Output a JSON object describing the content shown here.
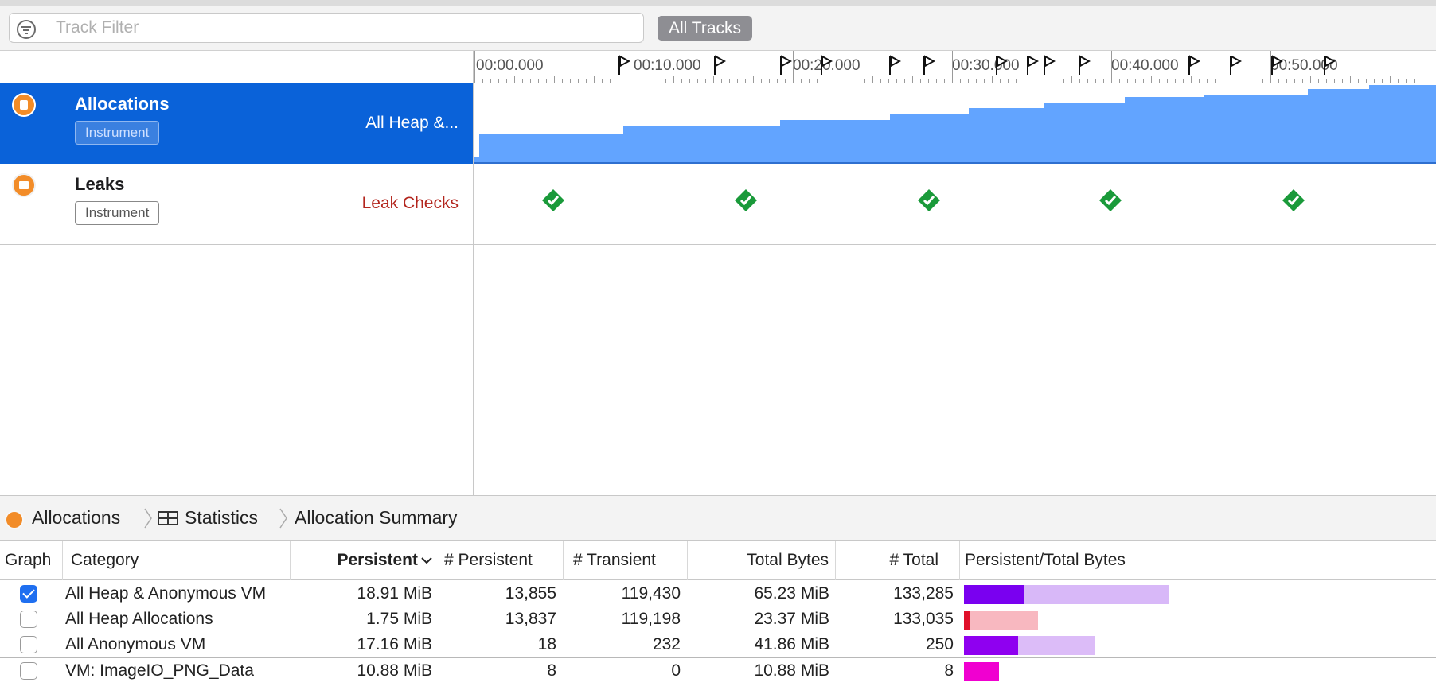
{
  "filter": {
    "placeholder": "Track Filter",
    "all_tracks_label": "All Tracks"
  },
  "ruler": {
    "labels": [
      "00:00.000",
      "00:10.000",
      "00:20.000",
      "00:30.000",
      "00:40.000",
      "00:50.000"
    ]
  },
  "tracks": [
    {
      "name": "Allocations",
      "badge": "Instrument",
      "subtitle": "All Heap &...",
      "selected": true
    },
    {
      "name": "Leaks",
      "badge": "Instrument",
      "subtitle": "Leak Checks",
      "leak_checks": 5
    }
  ],
  "breadcrumb": {
    "items": [
      "Allocations",
      "Statistics",
      "Allocation Summary"
    ]
  },
  "table": {
    "columns": [
      "Graph",
      "Category",
      "Persistent",
      "# Persistent",
      "# Transient",
      "Total Bytes",
      "# Total",
      "Persistent/Total Bytes"
    ],
    "sorted_column": "Persistent",
    "rows": [
      {
        "checked": true,
        "category": "All Heap & Anonymous VM",
        "persistent": "18.91 MiB",
        "n_persistent": "13,855",
        "n_transient": "119,430",
        "total_bytes": "65.23 MiB",
        "n_total": "133,285",
        "persistent_fraction": 0.29,
        "total_scale": 1.0,
        "color": "#7a00f0",
        "light": "#d8b8f8"
      },
      {
        "checked": false,
        "category": "All Heap Allocations",
        "persistent": "1.75 MiB",
        "n_persistent": "13,837",
        "n_transient": "119,198",
        "total_bytes": "23.37 MiB",
        "n_total": "133,035",
        "persistent_fraction": 0.075,
        "total_scale": 0.36,
        "color": "#e0102a",
        "light": "#f8b8c0"
      },
      {
        "checked": false,
        "category": "All Anonymous VM",
        "persistent": "17.16 MiB",
        "n_persistent": "18",
        "n_transient": "232",
        "total_bytes": "41.86 MiB",
        "n_total": "250",
        "persistent_fraction": 0.41,
        "total_scale": 0.64,
        "color": "#8f00f0",
        "light": "#dcbcf8"
      },
      {
        "checked": false,
        "category": "VM: ImageIO_PNG_Data",
        "persistent": "10.88 MiB",
        "n_persistent": "8",
        "n_transient": "0",
        "total_bytes": "10.88 MiB",
        "n_total": "8",
        "persistent_fraction": 1.0,
        "total_scale": 0.17,
        "color": "#f000d0",
        "light": "#f8b8f0"
      }
    ]
  },
  "colors": {
    "selection": "#0a62d9",
    "graph_fill": "#62a4ff",
    "leak_ok": "#1a9a3a",
    "instrument_icon": "#f28c28"
  }
}
